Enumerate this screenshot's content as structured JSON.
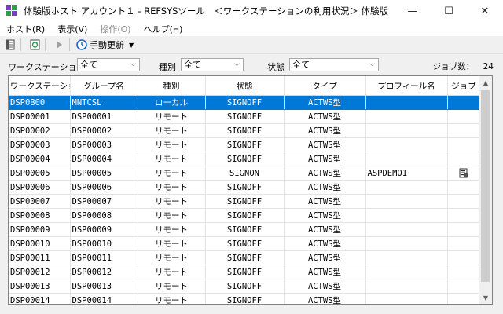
{
  "window": {
    "title": "体験版ホスト アカウント１ - REFSYSツール　＜ワークステーションの利用状況＞ 体験版",
    "minimize": "—",
    "maximize": "☐",
    "close": "✕"
  },
  "menu": [
    {
      "label": "ホスト(R)",
      "enabled": true
    },
    {
      "label": "表示(V)",
      "enabled": true
    },
    {
      "label": "操作(O)",
      "enabled": false
    },
    {
      "label": "ヘルプ(H)",
      "enabled": true
    }
  ],
  "toolbar": {
    "refresh_label": "手動更新"
  },
  "filters": {
    "workstation_label": "ワークステーション名",
    "workstation_value": "全て",
    "type_label": "種別",
    "type_value": "全て",
    "status_label": "状態",
    "status_value": "全て",
    "job_count_label": "ジョブ数：",
    "job_count": "24"
  },
  "table": {
    "columns": [
      "ワークステーション名",
      "グループ名",
      "種別",
      "状態",
      "タイプ",
      "プロフィール名",
      "ジョブ"
    ],
    "rows": [
      [
        "DSP0B00",
        "MNTCSL",
        "ローカル",
        "SIGNOFF",
        "ACTWS型",
        "",
        ""
      ],
      [
        "DSP00001",
        "DSP00001",
        "リモート",
        "SIGNOFF",
        "ACTWS型",
        "",
        ""
      ],
      [
        "DSP00002",
        "DSP00002",
        "リモート",
        "SIGNOFF",
        "ACTWS型",
        "",
        ""
      ],
      [
        "DSP00003",
        "DSP00003",
        "リモート",
        "SIGNOFF",
        "ACTWS型",
        "",
        ""
      ],
      [
        "DSP00004",
        "DSP00004",
        "リモート",
        "SIGNOFF",
        "ACTWS型",
        "",
        ""
      ],
      [
        "DSP00005",
        "DSP00005",
        "リモート",
        "SIGNON",
        "ACTWS型",
        "ASPDEMO1",
        "job-icon"
      ],
      [
        "DSP00006",
        "DSP00006",
        "リモート",
        "SIGNOFF",
        "ACTWS型",
        "",
        ""
      ],
      [
        "DSP00007",
        "DSP00007",
        "リモート",
        "SIGNOFF",
        "ACTWS型",
        "",
        ""
      ],
      [
        "DSP00008",
        "DSP00008",
        "リモート",
        "SIGNOFF",
        "ACTWS型",
        "",
        ""
      ],
      [
        "DSP00009",
        "DSP00009",
        "リモート",
        "SIGNOFF",
        "ACTWS型",
        "",
        ""
      ],
      [
        "DSP00010",
        "DSP00010",
        "リモート",
        "SIGNOFF",
        "ACTWS型",
        "",
        ""
      ],
      [
        "DSP00011",
        "DSP00011",
        "リモート",
        "SIGNOFF",
        "ACTWS型",
        "",
        ""
      ],
      [
        "DSP00012",
        "DSP00012",
        "リモート",
        "SIGNOFF",
        "ACTWS型",
        "",
        ""
      ],
      [
        "DSP00013",
        "DSP00013",
        "リモート",
        "SIGNOFF",
        "ACTWS型",
        "",
        ""
      ],
      [
        "DSP00014",
        "DSP00014",
        "リモート",
        "SIGNOFF",
        "ACTWS型",
        "",
        ""
      ]
    ],
    "selected_row": 0
  },
  "colors": {
    "selection": "#0078d7"
  }
}
